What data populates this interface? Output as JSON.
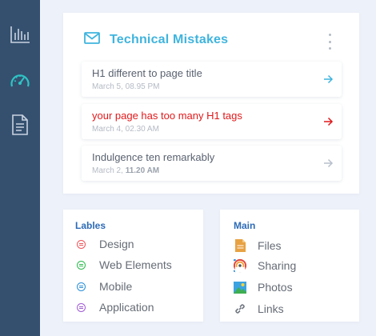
{
  "sidebar": {
    "icons": [
      "bar-chart-icon",
      "gauge-icon",
      "document-icon"
    ],
    "active_color": "#2ec4c4"
  },
  "technical_mistakes": {
    "title": "Technical Mistakes",
    "items": [
      {
        "title": "H1 different to page title",
        "date": "March 5, 08.95 PM",
        "time_bold": "",
        "color": "#5a6270",
        "arrow_color": "#3fb4de"
      },
      {
        "title": "your page has too many H1 tags",
        "date": "March 4, 02.30 AM",
        "time_bold": "",
        "color": "#e0191b",
        "arrow_color": "#e0191b"
      },
      {
        "title": "Indulgence ten remarkably",
        "date": "March 2, ",
        "time_bold": "11.20 AM",
        "color": "#5a6270",
        "arrow_color": "#b8c0cc"
      }
    ]
  },
  "labels": {
    "title": "Lables",
    "items": [
      {
        "label": "Design",
        "color": "#f0555a"
      },
      {
        "label": "Web Elements",
        "color": "#2dbb4f"
      },
      {
        "label": "Mobile",
        "color": "#2a8fd8"
      },
      {
        "label": "Application",
        "color": "#a05bd4"
      }
    ]
  },
  "main": {
    "title": "Main",
    "items": [
      {
        "label": "Files",
        "icon": "file-icon"
      },
      {
        "label": "Sharing",
        "icon": "sharing-icon"
      },
      {
        "label": "Photos",
        "icon": "photo-icon"
      },
      {
        "label": "Links",
        "icon": "link-icon"
      }
    ]
  }
}
